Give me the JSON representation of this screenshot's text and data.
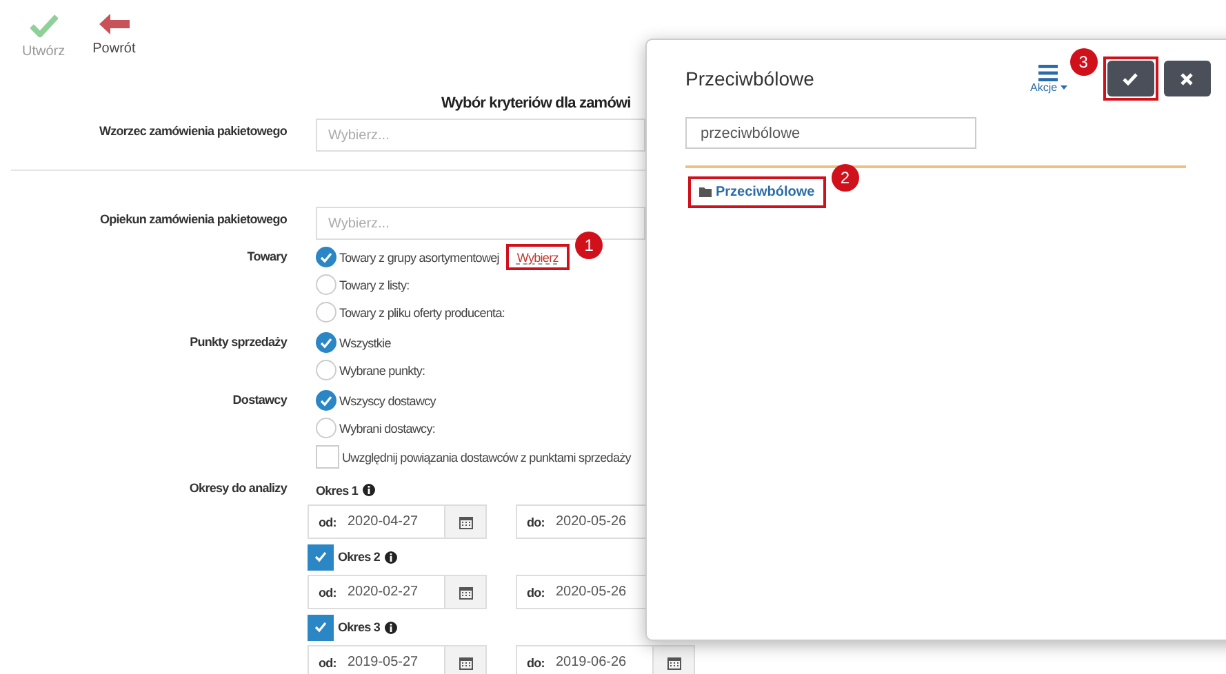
{
  "toolbar": [
    {
      "label": "Utwórz",
      "kind": "create",
      "disabled": true
    },
    {
      "label": "Powrót",
      "kind": "back",
      "disabled": false
    }
  ],
  "form": {
    "title": "Wybór kryteriów dla zamówi",
    "template": {
      "label": "Wzorzec zamówienia pakietowego",
      "placeholder": "Wybierz..."
    },
    "owner": {
      "label": "Opiekun zamówienia pakietowego",
      "placeholder": "Wybierz..."
    },
    "goods": {
      "label": "Towary",
      "options": [
        {
          "label": "Towary z grupy asortymentowej",
          "selected": true,
          "link": "Wybierz",
          "annotation": "1"
        },
        {
          "label": "Towary z listy:",
          "selected": false
        },
        {
          "label": "Towary z pliku oferty producenta:",
          "selected": false
        }
      ]
    },
    "points": {
      "label": "Punkty sprzedaży",
      "options": [
        {
          "label": "Wszystkie",
          "selected": true
        },
        {
          "label": "Wybrane punkty:",
          "selected": false
        }
      ]
    },
    "suppliers": {
      "label": "Dostawcy",
      "options": [
        {
          "label": "Wszyscy dostawcy",
          "selected": true
        },
        {
          "label": "Wybrani dostawcy:",
          "selected": false
        }
      ],
      "link_option": {
        "label": "Uwzględnij powiązania dostawców z punktami sprzedaży",
        "checked": false
      }
    },
    "periods": {
      "label": "Okresy do analizy",
      "items": [
        {
          "label": "Okres 1",
          "kind": "fixed",
          "from_label": "od:",
          "from": "2020-04-27",
          "to_label": "do:",
          "to": "2020-05-26"
        },
        {
          "label": "Okres 2",
          "kind": "optional",
          "checked": true,
          "from_label": "od:",
          "from": "2020-02-27",
          "to_label": "do:",
          "to": "2020-05-26"
        },
        {
          "label": "Okres 3",
          "kind": "optional",
          "checked": true,
          "from_label": "od:",
          "from": "2019-05-27",
          "to_label": "do:",
          "to": "2019-06-26"
        }
      ]
    }
  },
  "modal": {
    "title": "Przeciwbólowe",
    "actions_menu": {
      "label": "Akcje"
    },
    "confirm_annotation": "3",
    "search": {
      "value": "przeciwbólowe"
    },
    "tree": [
      {
        "label": "Przeciwbólowe",
        "kind": "folder",
        "annotation": "2"
      }
    ]
  }
}
